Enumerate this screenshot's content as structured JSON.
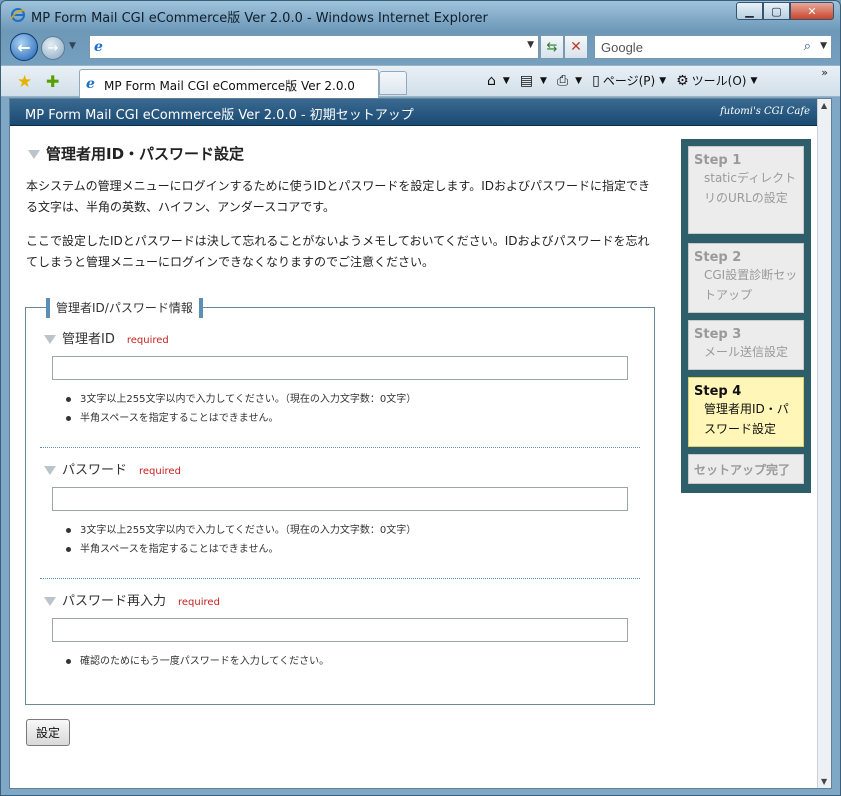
{
  "window": {
    "title": "MP Form Mail CGI eCommerce版 Ver 2.0.0 - Windows Internet Explorer",
    "buttons": {
      "minimize": "▁",
      "maximize": "▢",
      "close": "✕"
    }
  },
  "nav": {
    "address_value": "",
    "search_placeholder": "Google"
  },
  "tabs": {
    "active_label": "MP Form Mail CGI eCommerce版 Ver 2.0.0"
  },
  "command_bar": {
    "page_label": "ページ(P)",
    "tools_label": "ツール(O)"
  },
  "app": {
    "title": "MP Form Mail CGI eCommerce版 Ver 2.0.0 - 初期セットアップ",
    "brand": "futomi's CGI Cafe"
  },
  "main": {
    "heading": "管理者用ID・パスワード設定",
    "para1": "本システムの管理メニューにログインするために使うIDとパスワードを設定します。IDおよびパスワードに指定できる文字は、半角の英数、ハイフン、アンダースコアです。",
    "para2": "ここで設定したIDとパスワードは決して忘れることがないようメモしておいてください。IDおよびパスワードを忘れてしまうと管理メニューにログインできなくなりますのでご注意ください。",
    "fieldset_legend": "管理者ID/パスワード情報",
    "required_label": "required",
    "fields": [
      {
        "label": "管理者ID",
        "value": "",
        "hints": [
          "3文字以上255文字以内で入力してください。（現在の入力文字数：0文字）",
          "半角スペースを指定することはできません。"
        ]
      },
      {
        "label": "パスワード",
        "value": "",
        "hints": [
          "3文字以上255文字以内で入力してください。（現在の入力文字数：0文字）",
          "半角スペースを指定することはできません。"
        ]
      },
      {
        "label": "パスワード再入力",
        "value": "",
        "hints": [
          "確認のためにもう一度パスワードを入力してください。"
        ]
      }
    ],
    "submit_label": "設定"
  },
  "steps": [
    {
      "num": "Step 1",
      "desc": "staticディレクトリのURLの設定",
      "state": "inactive"
    },
    {
      "num": "Step 2",
      "desc": "CGI設置診断セットアップ",
      "state": "inactive"
    },
    {
      "num": "Step 3",
      "desc": "メール送信設定",
      "state": "inactive"
    },
    {
      "num": "Step 4",
      "desc": "管理者用ID・パスワード設定",
      "state": "active"
    },
    {
      "num": "セットアップ完了",
      "desc": "",
      "state": "inactive"
    }
  ],
  "colors": {
    "app_bar": "#1a4a72",
    "steps_panel": "#2e5e6a",
    "active_step": "#fff6b8",
    "required": "#c81e1e"
  },
  "icons": {
    "back": "back-arrow-icon",
    "forward": "forward-arrow-icon",
    "refresh": "refresh-icon",
    "stop": "stop-icon",
    "search": "magnifier-icon",
    "favorites": "star-icon",
    "add_favorite": "add-favorite-icon",
    "home": "home-icon",
    "feeds": "rss-icon",
    "print": "printer-icon",
    "page": "page-icon",
    "tools": "gear-icon"
  }
}
